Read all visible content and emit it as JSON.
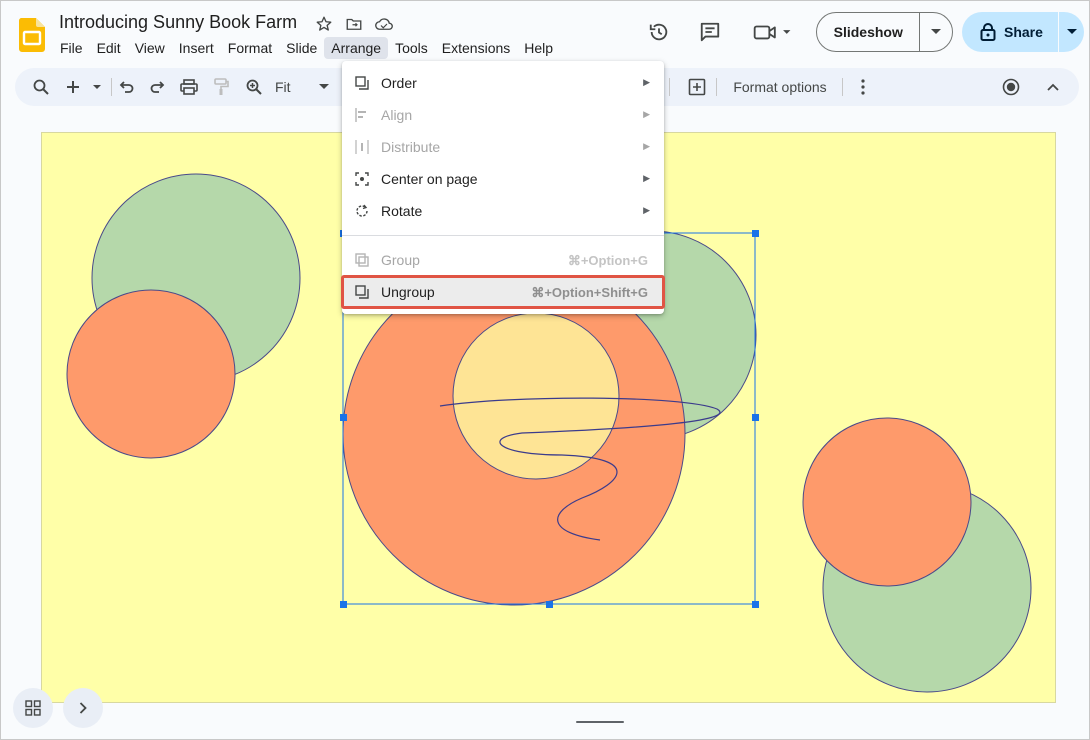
{
  "app": {
    "doc_title": "Introducing Sunny Book Farm",
    "logo_icon": "slides-logo-icon",
    "title_icons": [
      "star-icon",
      "move-to-folder-icon",
      "cloud-saved-icon"
    ]
  },
  "menubar": {
    "items": [
      "File",
      "Edit",
      "View",
      "Insert",
      "Format",
      "Slide",
      "Arrange",
      "Tools",
      "Extensions",
      "Help"
    ],
    "active": "Arrange"
  },
  "header_actions": {
    "history_icon": "history-icon",
    "comments_icon": "comments-icon",
    "meet_icon": "video-call-icon",
    "slideshow_label": "Slideshow",
    "share_label": "Share"
  },
  "toolbar": {
    "zoom_value": "Fit",
    "format_options_label": "Format options",
    "icons": [
      "search-icon",
      "add-icon",
      "undo-icon",
      "redo-icon",
      "print-icon",
      "paint-format-icon",
      "zoom-icon",
      "add-comment-icon",
      "more-vert-icon",
      "record-icon",
      "collapse-icon"
    ]
  },
  "arrange_menu": {
    "items": [
      {
        "label": "Order",
        "icon": "order-icon",
        "submenu": true,
        "disabled": false
      },
      {
        "label": "Align",
        "icon": "align-icon",
        "submenu": true,
        "disabled": true
      },
      {
        "label": "Distribute",
        "icon": "distribute-icon",
        "submenu": true,
        "disabled": true
      },
      {
        "label": "Center on page",
        "icon": "center-icon",
        "submenu": true,
        "disabled": false
      },
      {
        "label": "Rotate",
        "icon": "rotate-icon",
        "submenu": true,
        "disabled": false
      },
      {
        "label": "Group",
        "icon": "group-icon",
        "shortcut": "⌘+Option+G",
        "disabled": true
      },
      {
        "label": "Ungroup",
        "icon": "ungroup-icon",
        "shortcut": "⌘+Option+Shift+G",
        "disabled": false,
        "highlighted": true
      }
    ]
  },
  "colors": {
    "slide_bg": "#ffffa8",
    "circle_green": "#b5d8aa",
    "circle_orange": "#fe9a6b",
    "circle_yellow": "#fee495",
    "selection": "#1a73e8",
    "highlight_border": "#e05444"
  },
  "bottom": {
    "grid_icon": "grid-view-icon",
    "expand_icon": "chevron-right-icon"
  }
}
